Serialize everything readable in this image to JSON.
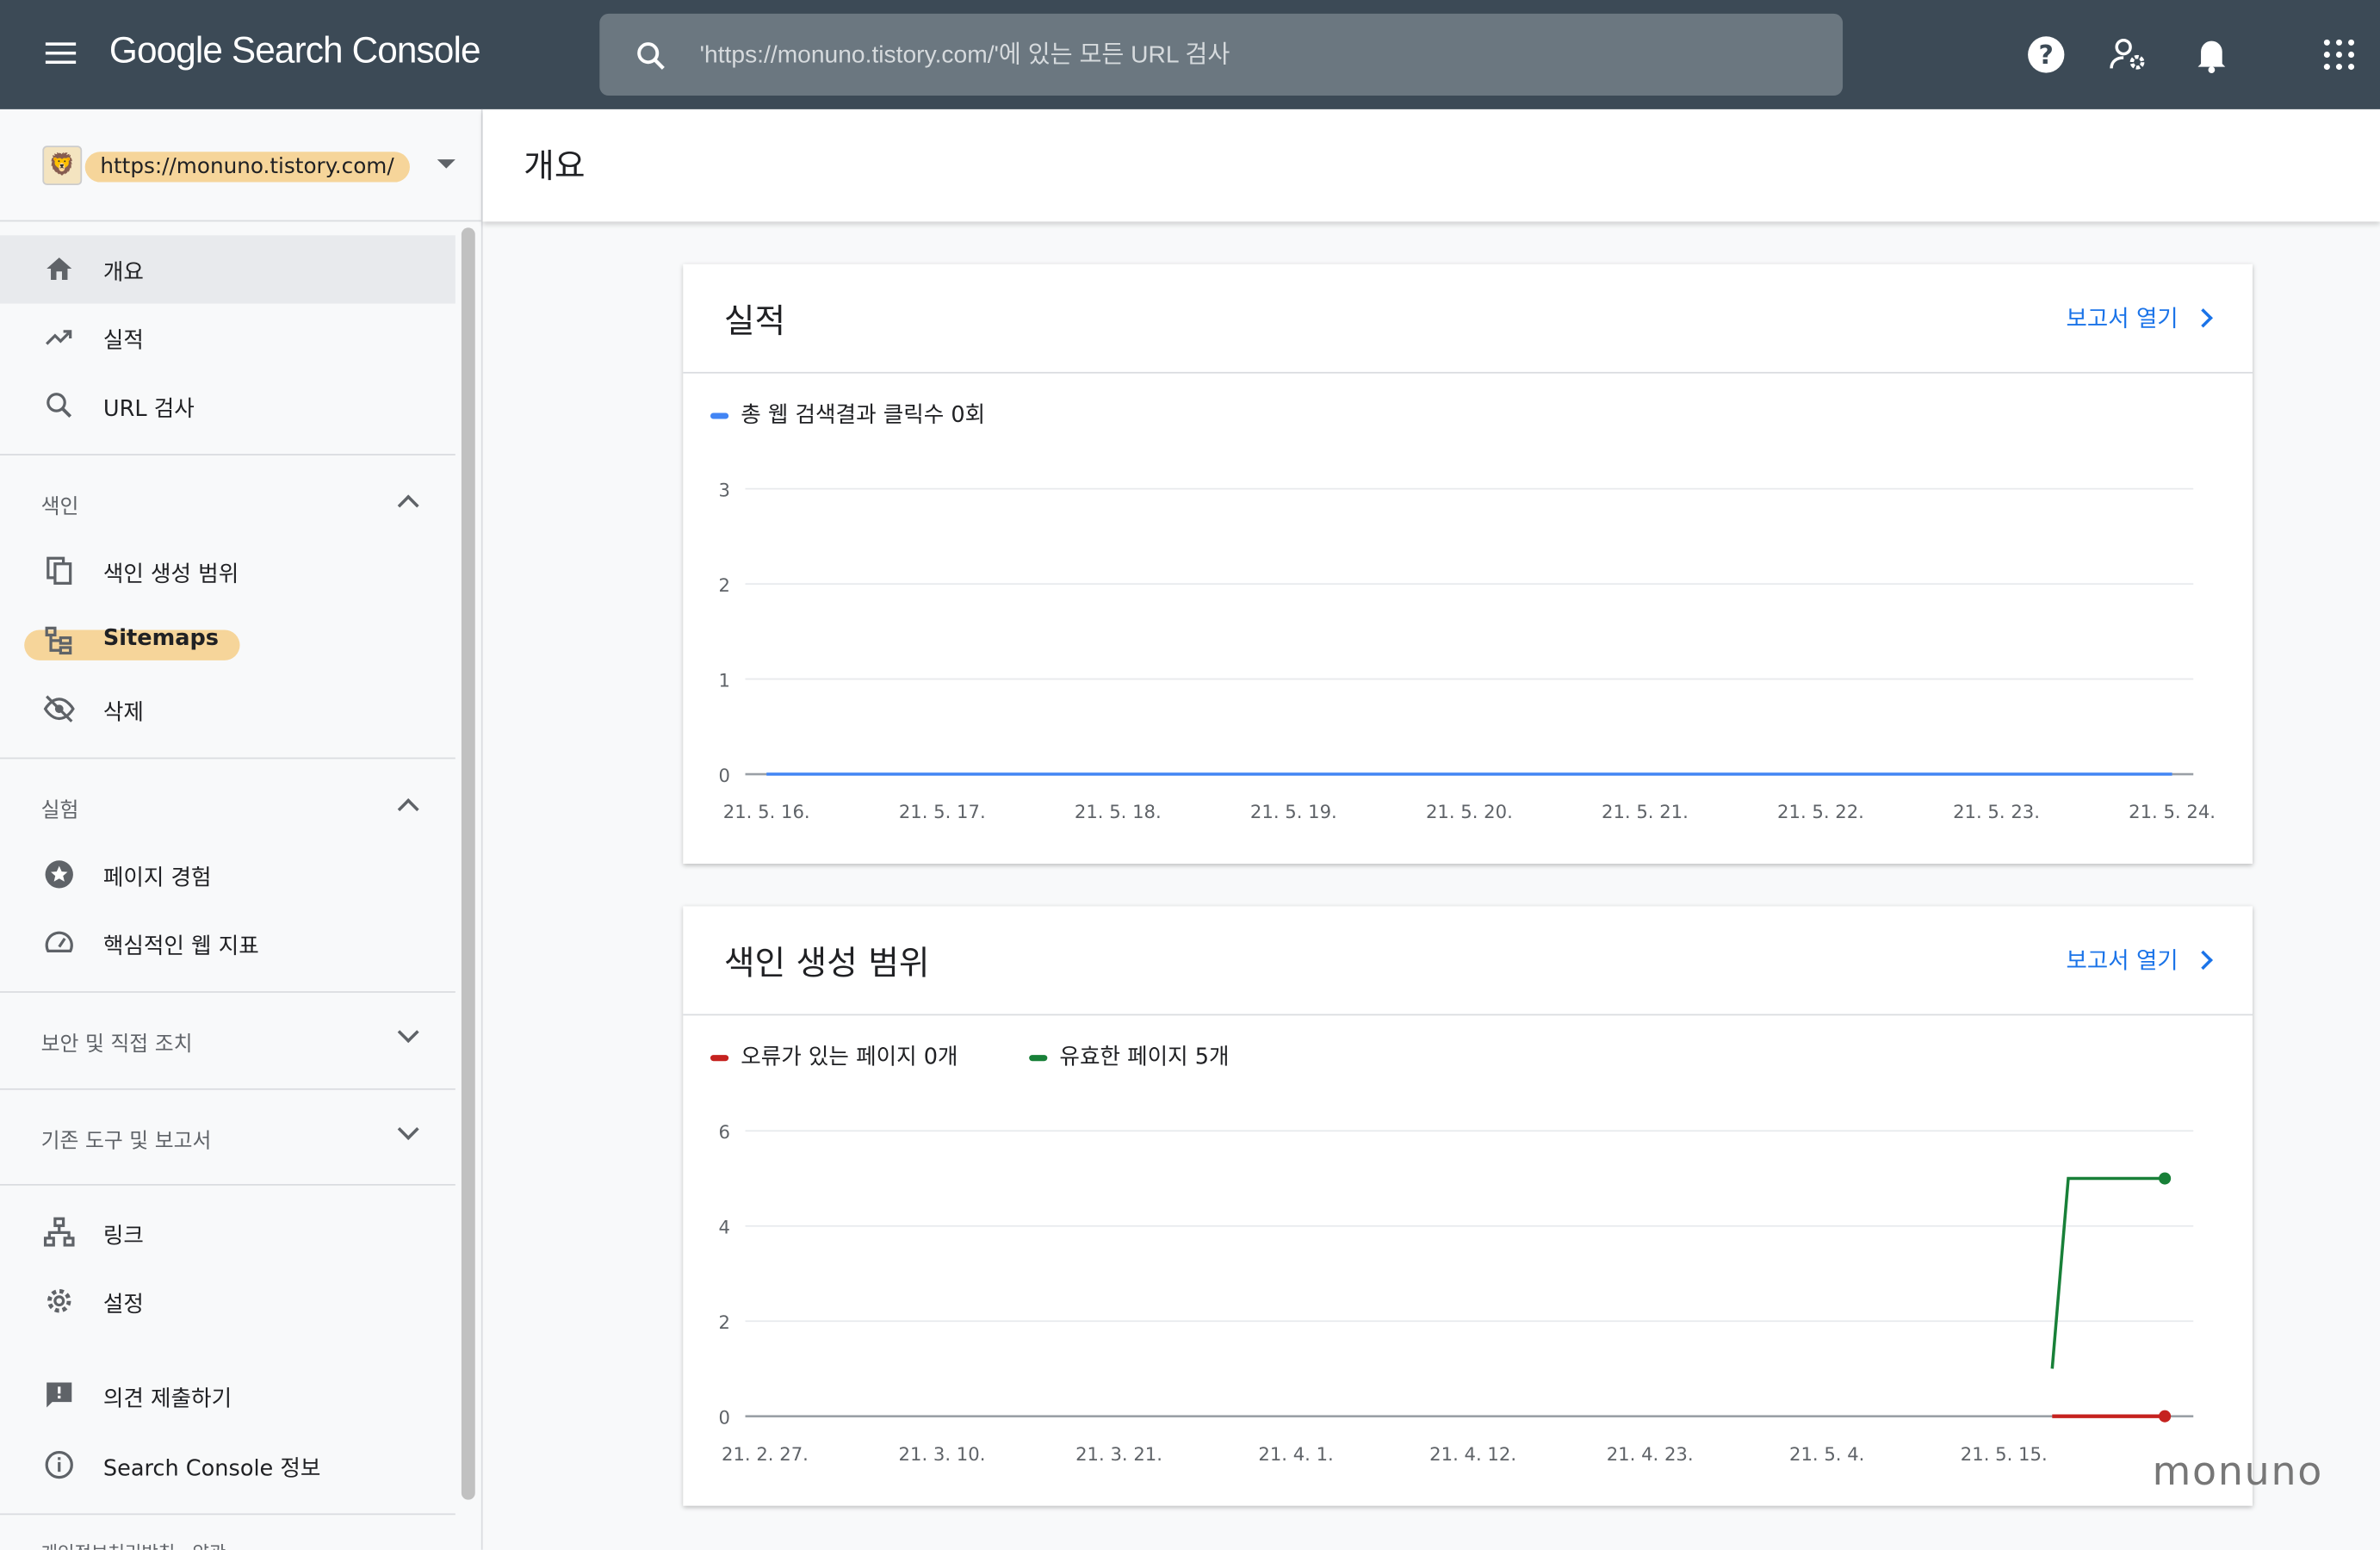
{
  "topbar": {
    "app_title": "Google Search Console",
    "search_placeholder": "'https://monuno.tistory.com/'에 있는 모든 URL 검사"
  },
  "property": {
    "url": "https://monuno.tistory.com/"
  },
  "sidebar": {
    "top_items": [
      {
        "label": "개요",
        "icon": "home-icon"
      },
      {
        "label": "실적",
        "icon": "trending-up-icon"
      },
      {
        "label": "URL 검사",
        "icon": "search-icon"
      }
    ],
    "sections": [
      {
        "label": "색인",
        "expanded": true,
        "items": [
          {
            "label": "색인 생성 범위",
            "icon": "copy-icon"
          },
          {
            "label": "Sitemaps",
            "icon": "sitemap-icon"
          },
          {
            "label": "삭제",
            "icon": "eye-off-icon"
          }
        ]
      },
      {
        "label": "실험",
        "expanded": true,
        "items": [
          {
            "label": "페이지 경험",
            "icon": "star-circle-icon"
          },
          {
            "label": "핵심적인 웹 지표",
            "icon": "gauge-icon"
          }
        ]
      },
      {
        "label": "보안 및 직접 조치",
        "expanded": false
      },
      {
        "label": "기존 도구 및 보고서",
        "expanded": false
      }
    ],
    "bottom_items": [
      {
        "label": "링크",
        "icon": "links-icon"
      },
      {
        "label": "설정",
        "icon": "gear-icon"
      },
      {
        "label": "의견 제출하기",
        "icon": "feedback-icon"
      },
      {
        "label": "Search Console 정보",
        "icon": "info-icon"
      }
    ],
    "footer": "개인정보처리방침 · 약관"
  },
  "header": {
    "title": "개요"
  },
  "cards": {
    "performance": {
      "title": "실적",
      "open_label": "보고서 열기",
      "legend": "총 웹 검색결과 클릭수 0회"
    },
    "coverage": {
      "title": "색인 생성 범위",
      "open_label": "보고서 열기",
      "legend_error": "오류가 있는 페이지 0개",
      "legend_valid": "유효한 페이지 5개"
    }
  },
  "watermark": "monuno",
  "chart_data": [
    {
      "type": "line",
      "ylim": [
        0,
        3
      ],
      "yticks": [
        "0",
        "1",
        "2",
        "3"
      ],
      "categories": [
        "21. 5. 16.",
        "21. 5. 17.",
        "21. 5. 18.",
        "21. 5. 19.",
        "21. 5. 20.",
        "21. 5. 21.",
        "21. 5. 22.",
        "21. 5. 23.",
        "21. 5. 24."
      ],
      "series": [
        {
          "name": "총 웹 검색결과 클릭수 0회",
          "color": "#4285f4",
          "values": [
            0,
            0,
            0,
            0,
            0,
            0,
            0,
            0,
            0
          ]
        }
      ],
      "grid": true
    },
    {
      "type": "line",
      "ylim": [
        0,
        6
      ],
      "yticks": [
        "0",
        "2",
        "4",
        "6"
      ],
      "xticks": [
        "21. 2. 27.",
        "21. 3. 10.",
        "21. 3. 21.",
        "21. 4. 1.",
        "21. 4. 12.",
        "21. 4. 23.",
        "21. 5. 4.",
        "21. 5. 15."
      ],
      "x_dates": [
        "2021-05-18",
        "2021-05-19",
        "2021-05-20",
        "2021-05-21",
        "2021-05-22",
        "2021-05-23",
        "2021-05-24",
        "2021-05-25"
      ],
      "series": [
        {
          "name": "유효한 페이지 5개",
          "color": "#188038",
          "values": [
            1,
            5,
            5,
            5,
            5,
            5,
            5,
            5
          ]
        },
        {
          "name": "오류가 있는 페이지 0개",
          "color": "#c5221f",
          "values": [
            0,
            0,
            0,
            0,
            0,
            0,
            0,
            0
          ]
        }
      ],
      "grid": true
    }
  ]
}
